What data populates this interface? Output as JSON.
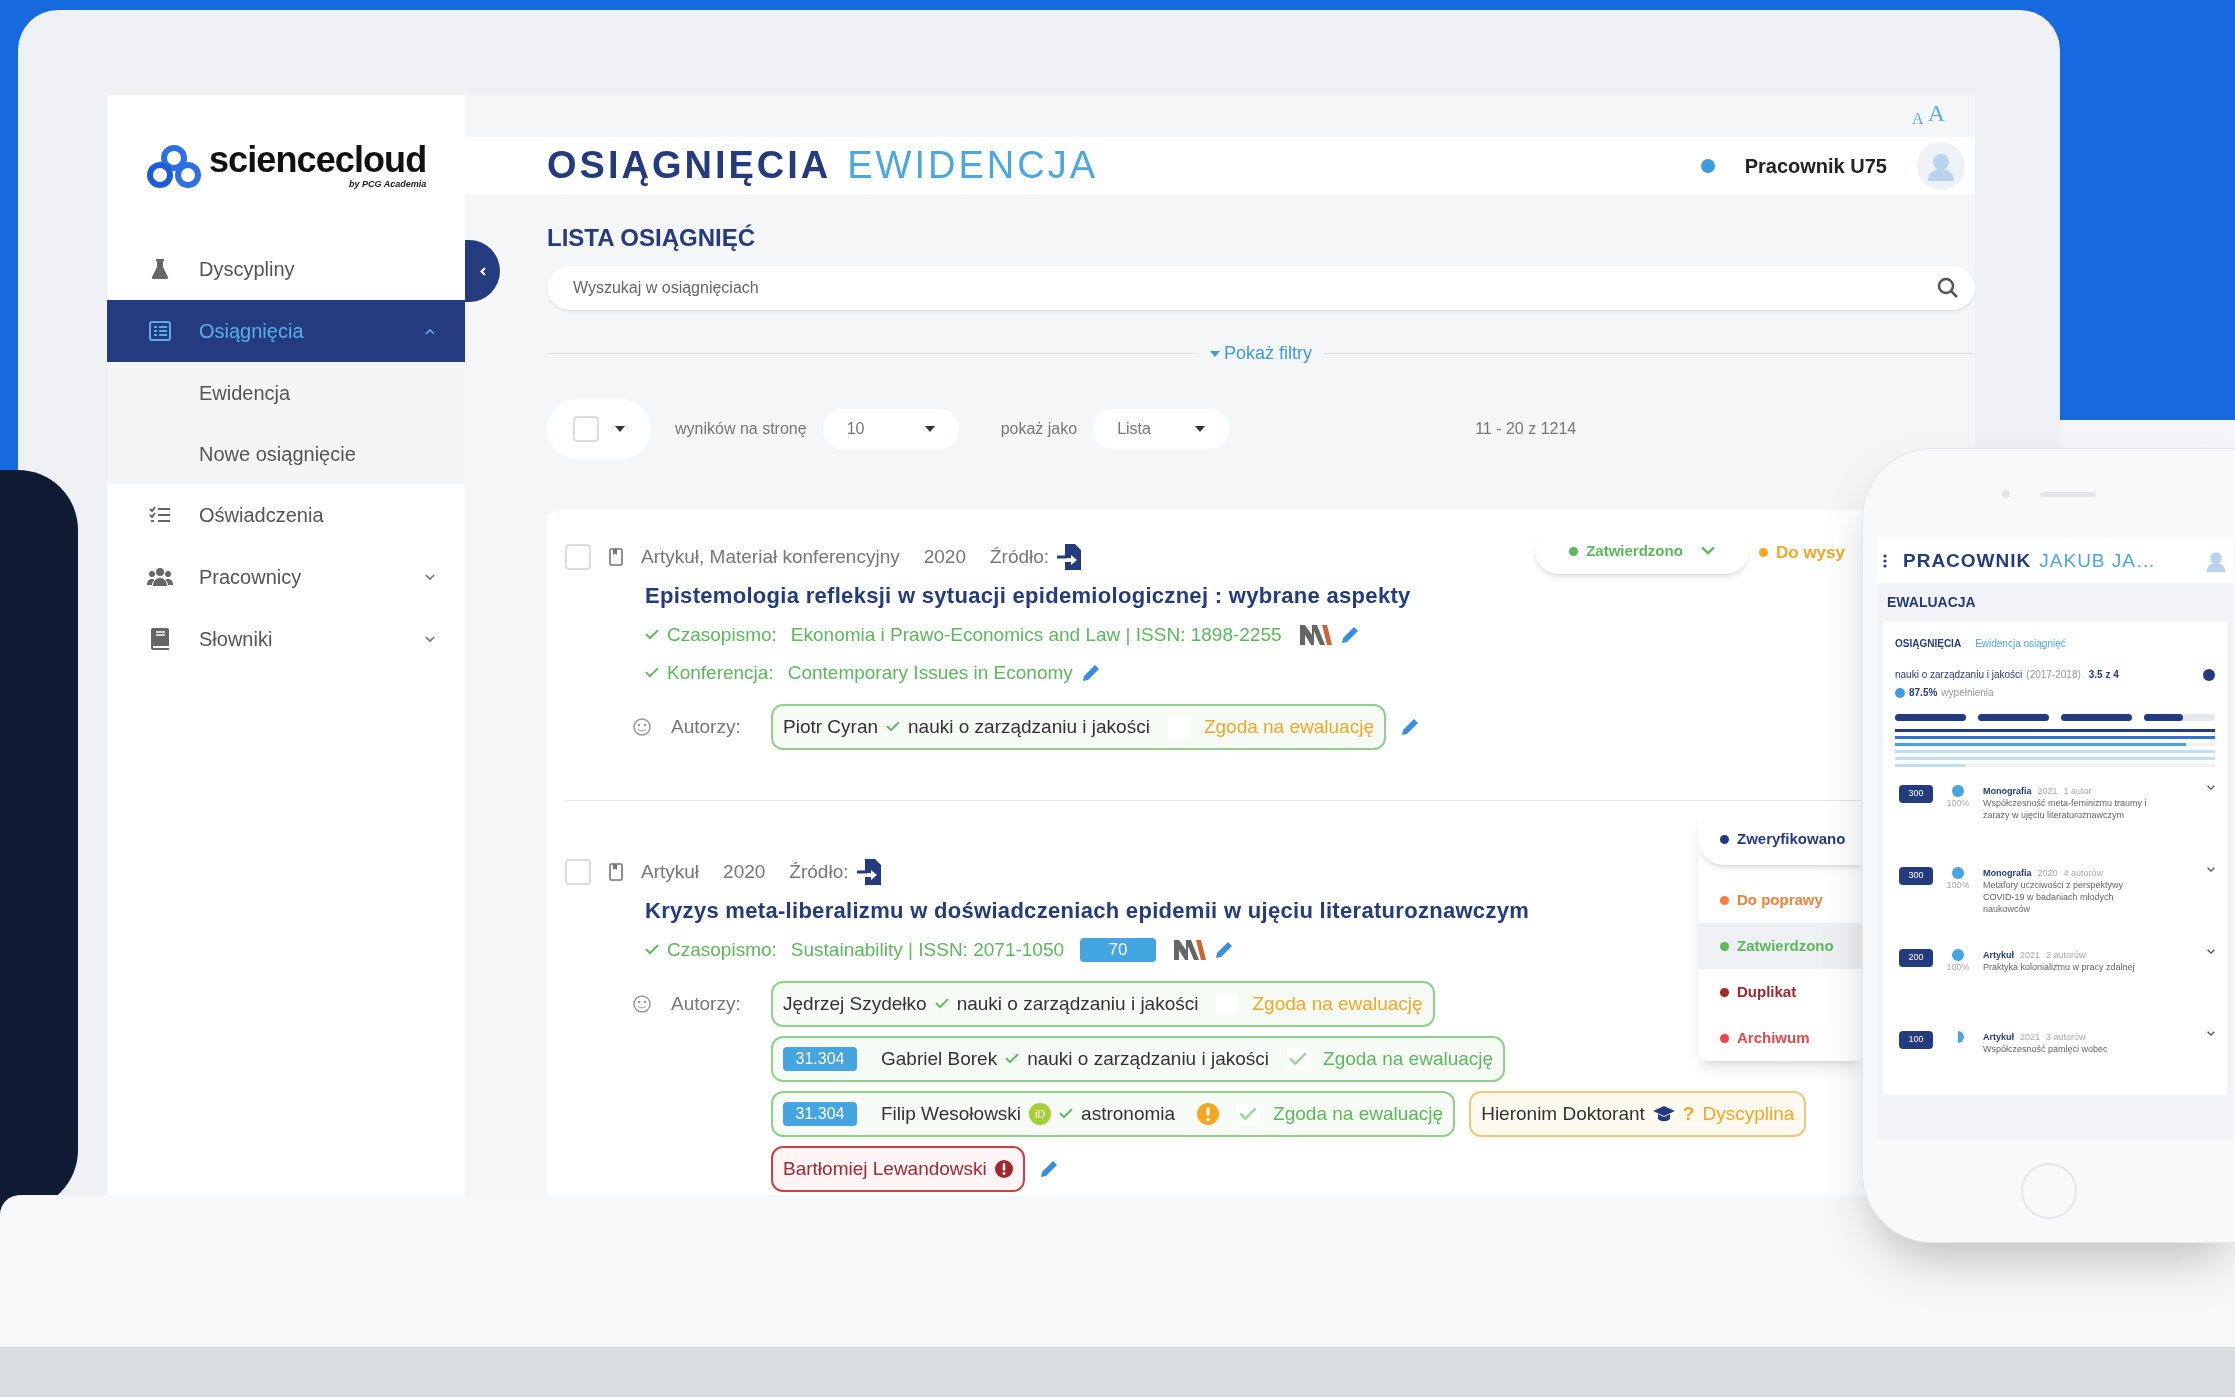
{
  "sidebar": {
    "logo": {
      "name": "sciencecloud",
      "tagline": "by PCG Academia"
    },
    "items": [
      {
        "label": "Dyscypliny",
        "kind": "link",
        "selected": false
      },
      {
        "label": "Osiągnięcia",
        "kind": "group",
        "selected": true,
        "expanded": true,
        "children": [
          {
            "label": "Ewidencja",
            "selected": false
          },
          {
            "label": "Nowe osiągnięcie",
            "selected": false
          }
        ]
      },
      {
        "label": "Oświadczenia",
        "kind": "link",
        "selected": false
      },
      {
        "label": "Pracownicy",
        "kind": "group",
        "selected": false,
        "expanded": false
      },
      {
        "label": "Słowniki",
        "kind": "group",
        "selected": false,
        "expanded": false
      }
    ]
  },
  "font_size": {
    "small": "A",
    "large": "A"
  },
  "header": {
    "title": "OSIĄGNIĘCIA",
    "subtitle": "EWIDENCJA",
    "user": "Pracownik U75",
    "online": true
  },
  "list": {
    "title": "LISTA OSIĄGNIĘĆ",
    "search": {
      "placeholder": "Wyszukaj w osiągnięciach"
    },
    "filters_toggle": "Pokaż filtry",
    "select_all_checked": false,
    "per_page_label": "wyników na stronę",
    "per_page": "10",
    "view_label": "pokaż jako",
    "view": "Lista",
    "range": "11 - 20 z 1214"
  },
  "achievements": [
    {
      "checked": false,
      "type": "Artykuł, Materiał konferencyjny",
      "year": "2020",
      "source_label": "Źródło:",
      "title": "Epistemologia refleksji w sytuacji epidemiologicznej : wybrane aspekty",
      "details": [
        {
          "kind": "journal",
          "label": "Czasopismo:",
          "value": "Ekonomia i Prawo-Economics and Law | ISSN: 1898-2255"
        },
        {
          "kind": "conference",
          "label": "Konferencja:",
          "value": "Contemporary Issues in Economy"
        }
      ],
      "authors_label": "Autorzy:",
      "authors": [
        {
          "kind": "ok",
          "name": "Piotr Cyran",
          "discipline": "nauki o zarządzaniu i jakości",
          "consent": {
            "label": "Zgoda na ewaluację",
            "checked": false
          }
        }
      ],
      "status": {
        "label": "Zatwierdzono",
        "color": "#5cb85c",
        "open": false
      },
      "next_status": {
        "label": "Do wysy",
        "color": "#f5a623"
      }
    },
    {
      "checked": false,
      "type": "Artykuł",
      "year": "2020",
      "source_label": "Źródło:",
      "title": "Kryzys meta-liberalizmu w doświadczeniach epidemii w ujęciu literaturoznawczym",
      "details": [
        {
          "kind": "journal",
          "label": "Czasopismo:",
          "value": "Sustainability | ISSN: 2071-1050",
          "points": "70"
        }
      ],
      "authors_label": "Autorzy:",
      "authors": [
        {
          "kind": "ok",
          "name": "Jędrzej Szydełko",
          "discipline": "nauki o zarządzaniu i jakości",
          "consent": {
            "label": "Zgoda na ewaluację",
            "checked": false
          }
        },
        {
          "kind": "ok",
          "score": "31.304",
          "name": "Gabriel Borek",
          "discipline": "nauki o zarządzaniu i jakości",
          "consent": {
            "label": "Zgoda na ewaluację",
            "checked": true
          }
        },
        {
          "kind": "ok",
          "score": "31.304",
          "name": "Filip Wesołowski",
          "orcid": "iD",
          "discipline": "astronomia",
          "warning": true,
          "consent": {
            "label": "Zgoda na ewaluację",
            "checked": true
          }
        },
        {
          "kind": "doctoral",
          "name": "Hieronim Doktorant",
          "marker": "?",
          "discipline": "Dyscyplina"
        },
        {
          "kind": "error",
          "name": "Bartłomiej Lewandowski"
        }
      ],
      "status": {
        "label": "Zweryfikowano",
        "color": "#243b80",
        "open": true,
        "options": [
          {
            "label": "Do poprawy",
            "color": "#f0803c",
            "selected": false
          },
          {
            "label": "Zatwierdzono",
            "color": "#5cb85c",
            "selected": true
          },
          {
            "label": "Duplikat",
            "color": "#a3282e",
            "selected": false
          },
          {
            "label": "Archiwum",
            "color": "#e8474c",
            "selected": false
          }
        ]
      }
    }
  ],
  "phone": {
    "title": "PRACOWNIK",
    "name": "JAKUB JA…",
    "section": "EWALUACJA",
    "tab": "OSIĄGNIĘCIA",
    "link": "Ewidencja osiągnięć",
    "discipline": "nauki o zarządzaniu i jakości",
    "period": "(2017-2018)",
    "slots": "3.5 z 4",
    "fill": "87.5%",
    "fill_label": "wypełnienia",
    "segments": [
      {
        "level": 1
      },
      {
        "level": 1
      },
      {
        "level": 1
      },
      {
        "level": 0.55
      }
    ],
    "lines": [
      {
        "level": 1
      },
      {
        "level": 1
      },
      {
        "level": 0.91
      },
      {
        "level": 1
      },
      {
        "level": 1
      },
      {
        "level": 0.22
      }
    ],
    "items": [
      {
        "points": "300",
        "kind": "full",
        "share": "100%",
        "type": "Monografia",
        "year": "2021",
        "authors": "1 autor",
        "title": "Współczesność meta-feminizmu traumy i zarazy w ujęciu literaturoznawczym"
      },
      {
        "points": "300",
        "kind": "full",
        "share": "100%",
        "type": "Monografia",
        "year": "2020",
        "authors": "4 autorów",
        "title": "Metafory uczciwości z perspektywy COVID-19 w badaniach młodych naukowców"
      },
      {
        "points": "200",
        "kind": "full",
        "share": "100%",
        "type": "Artykuł",
        "year": "2021",
        "authors": "2 autorów",
        "title": "Praktyka kolonializmu w pracy zdalnej"
      },
      {
        "points": "100",
        "kind": "half",
        "type": "Artykuł",
        "year": "2021",
        "authors": "3 autorów",
        "title": "Współczesność pamięci wobec"
      }
    ]
  }
}
